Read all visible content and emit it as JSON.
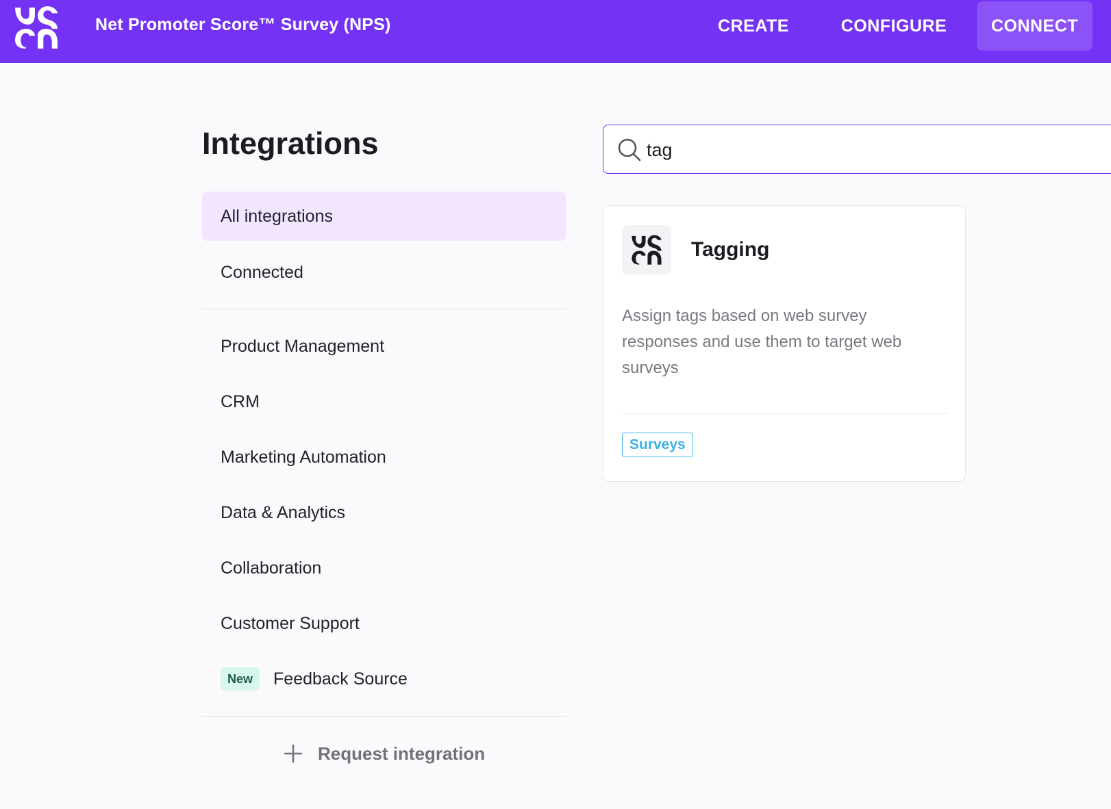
{
  "header": {
    "title": "Net Promoter Score™ Survey (NPS)",
    "nav": [
      {
        "label": "CREATE"
      },
      {
        "label": "CONFIGURE"
      },
      {
        "label": "CONNECT",
        "active": true
      }
    ],
    "logo_icon": "brand-logo-icon",
    "bar_color": "#7432f4"
  },
  "page": {
    "title": "Integrations"
  },
  "sidebar": {
    "items": [
      {
        "label": "All integrations",
        "active": true
      },
      {
        "label": "Connected"
      },
      {
        "label": "Product Management"
      },
      {
        "label": "CRM"
      },
      {
        "label": "Marketing Automation"
      },
      {
        "label": "Data & Analytics"
      },
      {
        "label": "Collaboration"
      },
      {
        "label": "Customer Support"
      },
      {
        "label": "Feedback Source",
        "badge": "New"
      }
    ],
    "request_label": "Request integration"
  },
  "search": {
    "value": "tag",
    "icon": "search-icon"
  },
  "results": [
    {
      "title": "Tagging",
      "description": "Assign tags based on web survey responses and use them to target web surveys",
      "tag": "Surveys",
      "tag_color": "#45b9ea"
    }
  ]
}
